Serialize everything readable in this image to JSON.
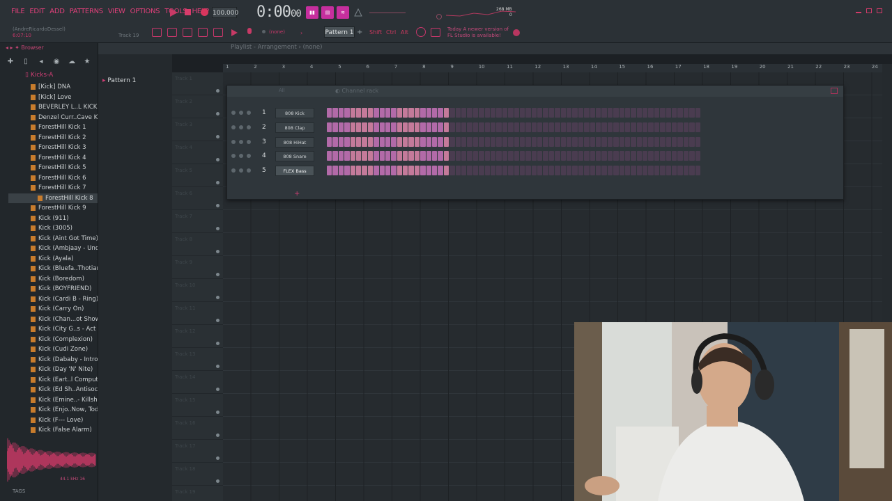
{
  "menu": [
    "FILE",
    "EDIT",
    "ADD",
    "PATTERNS",
    "VIEW",
    "OPTIONS",
    "TOOLS",
    "HELP"
  ],
  "hint": {
    "user": "(AndreRicardoDessel)",
    "time": "6:07:10",
    "track": "Track 19"
  },
  "transport": {
    "tempo": "100.000",
    "time": "0:00",
    "time_small": "00"
  },
  "memory": {
    "line1": "268 MB",
    "line2": "0"
  },
  "pattern": {
    "name": "Pattern 1",
    "none_label": "(none)"
  },
  "modifiers": [
    "Shift",
    "Ctrl",
    "Alt"
  ],
  "news": {
    "line1": "Today  A newer version of",
    "line2": "FL Studio is available!"
  },
  "browser": {
    "title": "Browser",
    "folder": "Kicks-A",
    "files": [
      "[Kick] DNA",
      "[Kick] Love",
      "BEVERLEY L..L KICK (1)",
      "Denzel Curr..Cave Kick",
      "ForestHill Kick 1",
      "ForestHill Kick 2",
      "ForestHill Kick 3",
      "ForestHill Kick 4",
      "ForestHill Kick 5",
      "ForestHill Kick 6",
      "ForestHill Kick 7",
      "ForestHill Kick 8",
      "ForestHill Kick 9",
      "Kick (911)",
      "Kick (3005)",
      "Kick (Aint Got Time)",
      "Kick (Ambjaay - Uno)",
      "Kick (Ayala)",
      "Kick (Bluefa..Thotiana)",
      "Kick (Boredom)",
      "Kick (BOYFRIEND)",
      "Kick (Cardi B - Ring)",
      "Kick (Carry On)",
      "Kick (Chan...ot Shower)",
      "Kick (City G..s - Act Up)",
      "Kick (Complexion)",
      "Kick (Cudi Zone)",
      "Kick (Dababy - Intro)",
      "Kick (Day 'N' Nite)",
      "Kick (Eart..l Computer)",
      "Kick (Ed Sh..Antisocial)",
      "Kick (Emine..- Killshot)",
      "Kick (Enjo..Now, Today)",
      "Kick (F--- Love)",
      "Kick (False Alarm)"
    ],
    "selected_index": 11,
    "sample_info": "44.1 kHz 16",
    "tags_label": "TAGS"
  },
  "picker": {
    "item": "Pattern 1"
  },
  "playlist": {
    "title": "Playlist - Arrangement › (none)",
    "bars": [
      "1",
      "2",
      "3",
      "4",
      "5",
      "6",
      "7",
      "8",
      "9",
      "10",
      "11",
      "12",
      "13",
      "14",
      "15",
      "16",
      "17",
      "18",
      "19",
      "20",
      "21",
      "22",
      "23",
      "24"
    ]
  },
  "tracks": [
    "Track 1",
    "Track 2",
    "Track 3",
    "Track 4",
    "Track 5",
    "Track 6",
    "Track 7",
    "Track 8",
    "Track 9",
    "Track 10",
    "Track 11",
    "Track 12",
    "Track 13",
    "Track 14",
    "Track 15",
    "Track 16",
    "Track 17",
    "Track 18",
    "Track 19"
  ],
  "channel_rack": {
    "title": "Channel rack",
    "filter": "All",
    "channels": [
      {
        "num": "1",
        "name": "808 Kick"
      },
      {
        "num": "2",
        "name": "808 Clap"
      },
      {
        "num": "3",
        "name": "808 HiHat"
      },
      {
        "num": "4",
        "name": "808 Snare"
      },
      {
        "num": "5",
        "name": "FLEX Bass"
      }
    ],
    "selected_channel": 4,
    "steps_per_row": 64,
    "active_steps": 21
  },
  "colors": {
    "accent": "#d23b6a",
    "step_on": "#b26aa8",
    "step_off": "#4a3c50",
    "folder": "#c87c2c"
  },
  "icons": [
    "play-icon",
    "stop-icon",
    "record-icon",
    "chevron-down-icon",
    "plus-icon",
    "star-icon",
    "cloud-icon"
  ]
}
